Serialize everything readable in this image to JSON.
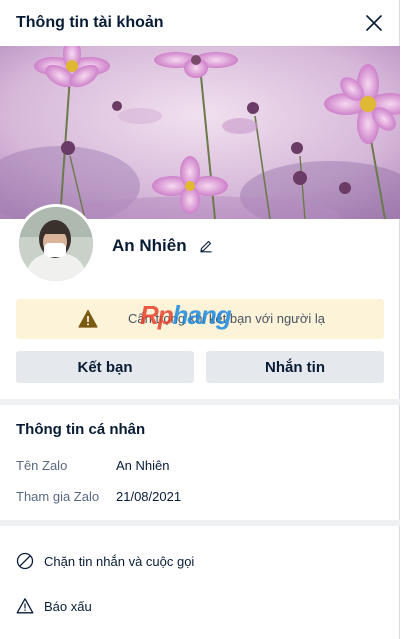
{
  "header": {
    "title": "Thông tin tài khoản",
    "close_icon": "close-icon"
  },
  "profile": {
    "name": "An Nhiên",
    "edit_icon": "pencil-icon"
  },
  "warning": {
    "text": "Cẩn trọng khi kết bạn với người lạ",
    "icon": "warning-triangle-icon",
    "background": "#fdf3d9"
  },
  "watermark": {
    "part1": "Rp",
    "part2": "hang"
  },
  "actions_top": {
    "add_friend_label": "Kết bạn",
    "message_label": "Nhắn tin"
  },
  "personal_info": {
    "title": "Thông tin cá nhân",
    "rows": [
      {
        "label": "Tên Zalo",
        "value": "An Nhiên"
      },
      {
        "label": "Tham gia Zalo",
        "value": "21/08/2021"
      }
    ]
  },
  "bottom_actions": [
    {
      "label": "Chặn tin nhắn và cuộc gọi",
      "icon": "block-icon"
    },
    {
      "label": "Báo xấu",
      "icon": "report-warning-icon"
    }
  ],
  "colors": {
    "text_primary": "#081c36",
    "text_secondary": "#5a6981",
    "button_bg": "#e5e8ec",
    "divider": "#eef0f1"
  }
}
